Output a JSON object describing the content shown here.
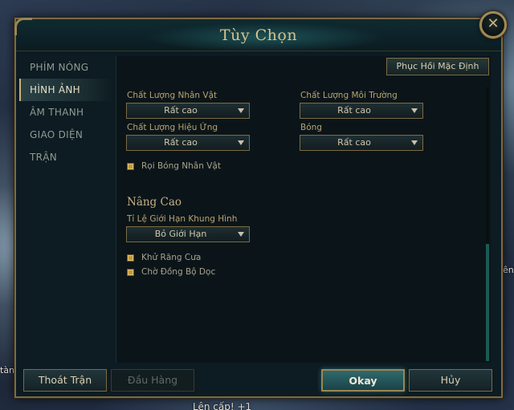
{
  "background": {
    "left_text": "tàn",
    "right_text": "ên",
    "level_up": "Lên cấp! +1"
  },
  "window": {
    "title": "Tùy Chọn",
    "close_symbol": "✕",
    "accent_color": "#c9b27a"
  },
  "sidebar": {
    "items": [
      {
        "label": "PHÍM NÓNG",
        "active": false
      },
      {
        "label": "HÌNH ẢNH",
        "active": true
      },
      {
        "label": "ÂM THANH",
        "active": false
      },
      {
        "label": "GIAO DIỆN",
        "active": false
      },
      {
        "label": "TRẬN",
        "active": false
      }
    ]
  },
  "content": {
    "restore_button": "Phục Hồi Mặc Định",
    "character_quality": {
      "label": "Chất Lượng Nhân Vật",
      "value": "Rất cao"
    },
    "environment_quality": {
      "label": "Chất Lượng Môi Trường",
      "value": "Rất cao"
    },
    "effects_quality": {
      "label": "Chất Lượng Hiệu Ứng",
      "value": "Rất cao"
    },
    "shadows": {
      "label": "Bóng",
      "value": "Rất cao"
    },
    "character_shadows": {
      "label": "Rọi Bóng Nhân Vật",
      "checked": true
    },
    "advanced_heading": "Nâng Cao",
    "frame_rate_cap": {
      "label": "Tỉ Lệ Giới Hạn Khung Hình",
      "value": "Bỏ Giới Hạn"
    },
    "anti_aliasing": {
      "label": "Khử Răng Cưa",
      "checked": true
    },
    "vsync": {
      "label": "Chờ Đồng Bộ Dọc",
      "checked": true
    }
  },
  "footer": {
    "exit_game": "Thoát Trận",
    "surrender": "Đầu Hàng",
    "okay": "Okay",
    "cancel": "Hủy"
  }
}
